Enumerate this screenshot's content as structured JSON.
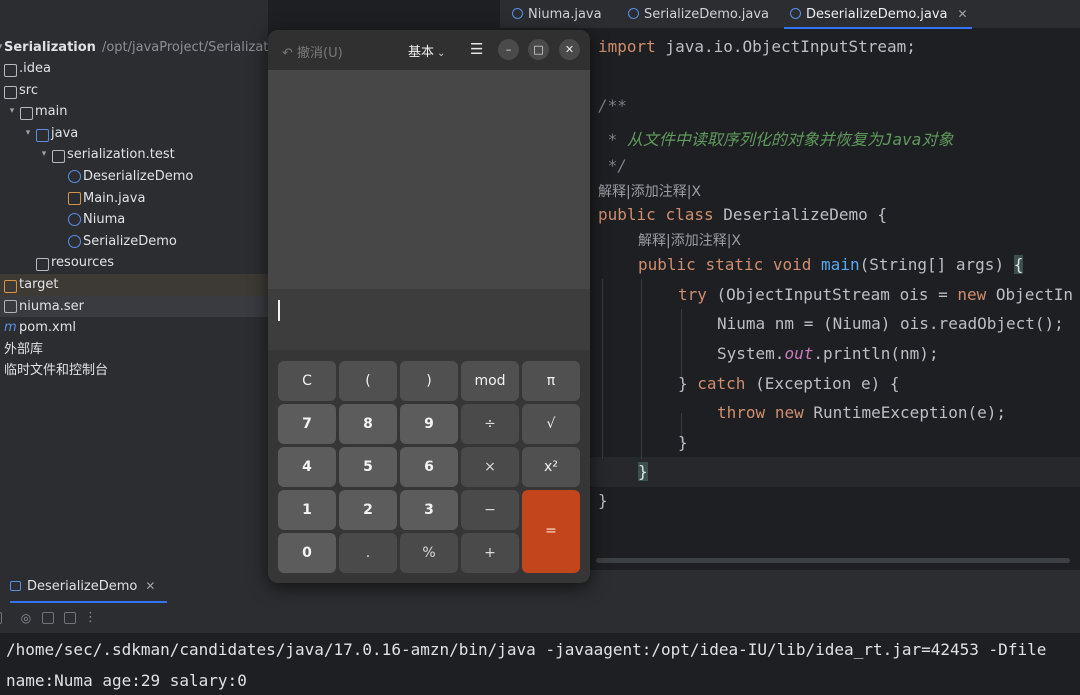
{
  "project_tree": {
    "root_name": "Serialization",
    "root_path": "/opt/javaProject/Serialization",
    "items": [
      {
        "label": ".idea",
        "kind": "folder"
      },
      {
        "label": "src",
        "kind": "folder"
      },
      {
        "label": "main",
        "kind": "folder"
      },
      {
        "label": "java",
        "kind": "folder-blue"
      },
      {
        "label": "serialization.test",
        "kind": "package"
      },
      {
        "label": "DeserializeDemo",
        "kind": "class"
      },
      {
        "label": "Main.java",
        "kind": "java-file"
      },
      {
        "label": "Niuma",
        "kind": "class"
      },
      {
        "label": "SerializeDemo",
        "kind": "class"
      },
      {
        "label": "resources",
        "kind": "folder"
      },
      {
        "label": "target",
        "kind": "folder-orange"
      },
      {
        "label": "niuma.ser",
        "kind": "file"
      },
      {
        "label": "pom.xml",
        "kind": "maven"
      },
      {
        "label": "外部库",
        "kind": "text"
      },
      {
        "label": "临时文件和控制台",
        "kind": "text"
      }
    ]
  },
  "editor_tabs": [
    {
      "label": "Niuma.java",
      "active": false
    },
    {
      "label": "SerializeDemo.java",
      "active": false
    },
    {
      "label": "DeserializeDemo.java",
      "active": true
    }
  ],
  "tab_close_glyph": "✕",
  "code": {
    "import_kw": "import",
    "import_rest": " java.io.ObjectInputStream;",
    "doc_open": "/**",
    "doc_star": " * ",
    "doc_text": "从文件中读取序列化的对象并恢复为Java对象",
    "doc_close": " */",
    "hint_1": "解释|添加注释|X",
    "public_kw": "public",
    "class_kw": "class",
    "class_name": " DeserializeDemo {",
    "hint_2": "解释|添加注释|X",
    "static_kw": "static",
    "void_kw": "void",
    "main_fn": "main",
    "main_params": "(String[] args) ",
    "open_brace": "{",
    "try_kw": "try",
    "try_rest_a": " (ObjectInputStream ois = ",
    "new_kw": "new",
    "try_rest_b": " ObjectIn",
    "niuma_line": "Niuma nm = (Niuma) ois.readObject();",
    "sysout_a": "System.",
    "sysout_out": "out",
    "sysout_b": ".println(nm);",
    "catch_open": "} ",
    "catch_kw": "catch",
    "catch_rest": " (Exception e) {",
    "throw_kw": "throw",
    "throw_rest": " RuntimeException(e);",
    "close_brace": "}"
  },
  "run_panel": {
    "tab_label": "DeserializeDemo",
    "console_lines": [
      "/home/sec/.sdkman/candidates/java/17.0.16-amzn/bin/java -javaagent:/opt/idea-IU/lib/idea_rt.jar=42453 -Dfile",
      "name:Numa age:29 salary:0"
    ]
  },
  "calculator": {
    "undo_label": "撤消(U)",
    "mode_label": "基本",
    "menu_glyph": "☰",
    "window_buttons": [
      "–",
      "□",
      "✕"
    ],
    "keys": [
      [
        "C",
        "(",
        ")",
        "mod",
        "π"
      ],
      [
        "7",
        "8",
        "9",
        "÷",
        "√"
      ],
      [
        "4",
        "5",
        "6",
        "×",
        "x²"
      ],
      [
        "1",
        "2",
        "3",
        "−",
        "="
      ],
      [
        "0",
        ".",
        "%",
        "+"
      ]
    ],
    "accent_color": "#c3451c"
  }
}
